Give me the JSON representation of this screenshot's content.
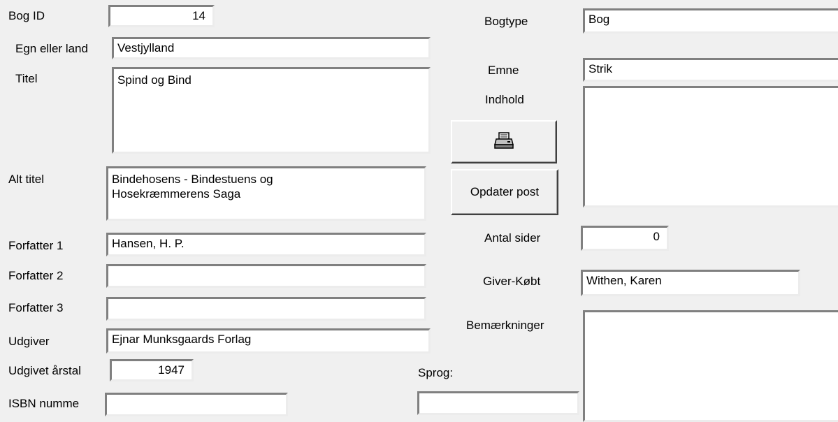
{
  "form": {
    "bog_id": {
      "label": "Bog ID",
      "value": "14"
    },
    "egn": {
      "label": "Egn eller land",
      "value": "Vestjylland"
    },
    "titel": {
      "label": "Titel",
      "value": "Spind og Bind"
    },
    "alt_titel": {
      "label": "Alt titel",
      "value": "Bindehosens - Bindestuens og\nHosekræmmerens Saga"
    },
    "forfatter1": {
      "label": "Forfatter 1",
      "value": "Hansen, H. P."
    },
    "forfatter2": {
      "label": "Forfatter 2",
      "value": ""
    },
    "forfatter3": {
      "label": "Forfatter 3",
      "value": ""
    },
    "udgiver": {
      "label": "Udgiver",
      "value": "Ejnar Munksgaards Forlag"
    },
    "udgivet_aar": {
      "label": "Udgivet årstal",
      "value": "1947"
    },
    "isbn": {
      "label": "ISBN numme",
      "value": ""
    },
    "sprog": {
      "label": "Sprog:",
      "value": ""
    },
    "bogtype": {
      "label": "Bogtype",
      "value": "Bog"
    },
    "emne": {
      "label": "Emne",
      "value": "Strik"
    },
    "indhold": {
      "label": "Indhold",
      "value": ""
    },
    "antal_sider": {
      "label": "Antal sider",
      "value": "0"
    },
    "giver_koebt": {
      "label": "Giver-Købt",
      "value": "Withen, Karen"
    },
    "bemaerkninger": {
      "label": "Bemærkninger",
      "value": ""
    }
  },
  "buttons": {
    "print_icon": "printer-icon",
    "opdater_label": "Opdater post"
  }
}
